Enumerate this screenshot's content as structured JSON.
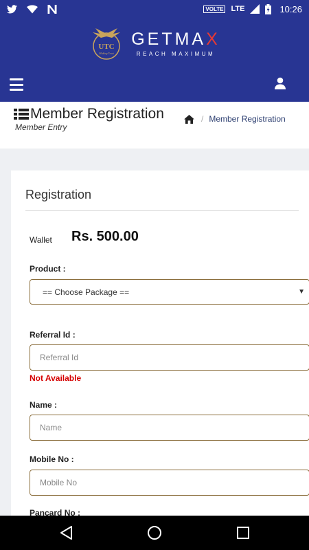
{
  "status_bar": {
    "network_label": "VOLTE",
    "lte_label": "LTE",
    "time": "10:26",
    "icons": [
      "twitter-icon",
      "wifi-icon",
      "n-app-icon",
      "signal-icon",
      "battery-icon"
    ]
  },
  "brand": {
    "emblem_text": "UTC",
    "emblem_tagline": "Making Trust",
    "name_prefix": "GETMA",
    "name_suffix": "X",
    "tagline": "REACH MAXIMUM"
  },
  "nav": {
    "menu_icon": "hamburger-menu-icon",
    "user_icon": "user-icon"
  },
  "page_header": {
    "title": "Member Registration",
    "subtitle": "Member Entry",
    "breadcrumb": {
      "home_icon": "home-icon",
      "current": "Member Registration"
    }
  },
  "form": {
    "card_title": "Registration",
    "wallet": {
      "label": "Wallet",
      "value": "Rs. 500.00"
    },
    "product": {
      "label": "Product :",
      "selected": "== Choose Package =="
    },
    "referral": {
      "label": "Referral Id :",
      "placeholder": "Referral Id",
      "value": "",
      "status": "Not Available"
    },
    "name": {
      "label": "Name :",
      "placeholder": "Name",
      "value": ""
    },
    "mobile": {
      "label": "Mobile No :",
      "placeholder": "Mobile No",
      "value": ""
    },
    "pancard": {
      "label": "Pancard No :"
    }
  },
  "colors": {
    "header_blue": "#283593",
    "field_border": "#8a6d3b",
    "error_red": "#d50000",
    "brand_x_red": "#e53935"
  },
  "system_nav": {
    "icons": [
      "back-icon",
      "home-circle-icon",
      "recents-icon"
    ]
  }
}
